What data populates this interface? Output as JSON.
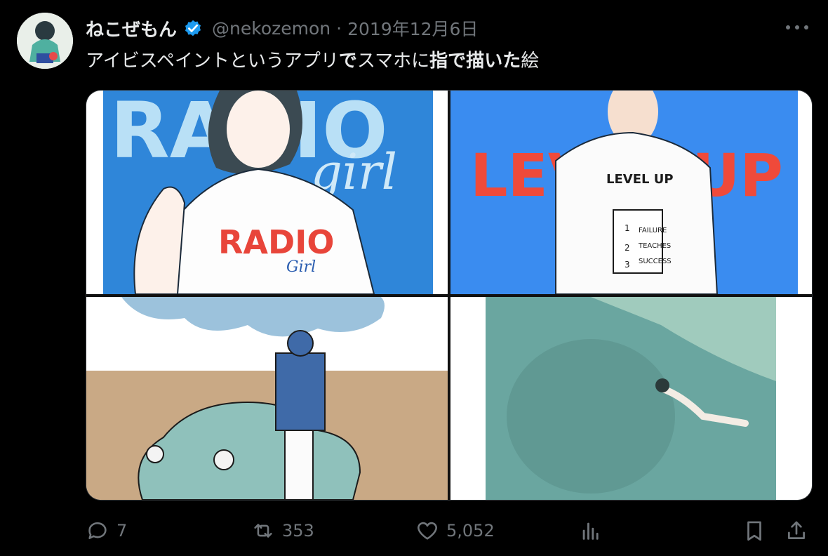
{
  "tweet": {
    "display_name": "ねこぜもん",
    "handle": "@nekozemon",
    "separator": "·",
    "date": "2019年12月6日",
    "text_parts": [
      {
        "t": "アイビスペイントというアプリ",
        "bold": false
      },
      {
        "t": "で",
        "bold": true
      },
      {
        "t": "スマホ",
        "bold": false
      },
      {
        "t": "に",
        "bold": false
      },
      {
        "t": "指",
        "bold": true
      },
      {
        "t": "で",
        "bold": true
      },
      {
        "t": "描いた",
        "bold": true
      },
      {
        "t": "絵",
        "bold": false
      }
    ]
  },
  "media": {
    "panel1": {
      "shirt_text": "RADIO",
      "shirt_sub": "Girl",
      "bg_text": "RADIO",
      "bg_sub": "girl"
    },
    "panel2": {
      "bg_text": "LEVEL UP",
      "shirt_title": "LEVEL UP",
      "box_1": "1",
      "box_2": "2",
      "box_3": "3",
      "motto_1": "FAILURE",
      "motto_2": "TEACHES",
      "motto_3": "SUCCESS"
    }
  },
  "actions": {
    "replies": "7",
    "reposts": "353",
    "likes": "5,052"
  },
  "icons": [
    "verified-badge-icon",
    "more-icon",
    "reply-icon",
    "repost-icon",
    "like-icon",
    "views-icon",
    "bookmark-icon",
    "share-icon"
  ],
  "colors": {
    "verified": "#1d9bf0",
    "muted": "#71767b",
    "text": "#e7e9ea"
  }
}
